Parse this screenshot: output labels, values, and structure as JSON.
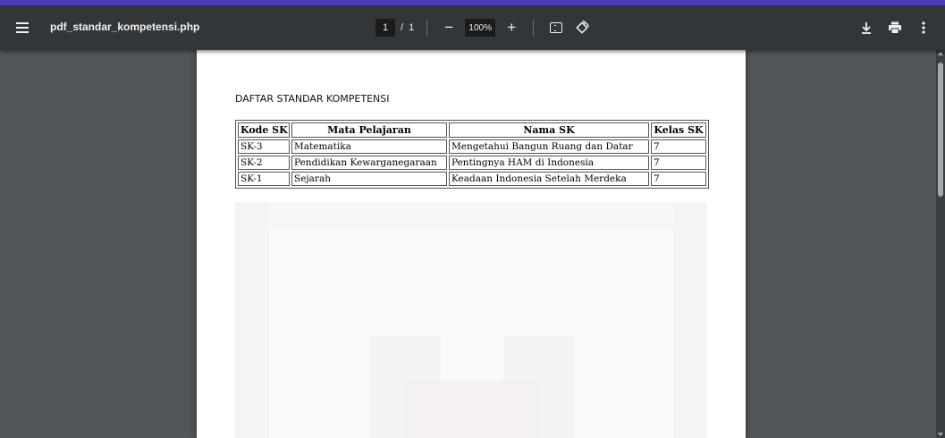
{
  "toolbar": {
    "file_name": "pdf_standar_kompetensi.php",
    "page_current": "1",
    "page_separator": "/",
    "page_total": "1",
    "zoom_level": "100%",
    "zoom_out_symbol": "−",
    "zoom_in_symbol": "+",
    "icons": [
      "menu-icon",
      "fit-page-icon",
      "rotate-icon",
      "download-icon",
      "print-icon",
      "more-options-icon"
    ]
  },
  "document": {
    "title": "DAFTAR STANDAR KOMPETENSI",
    "table": {
      "headers": [
        "Kode SK",
        "Mata Pelajaran",
        "Nama SK",
        "Kelas SK"
      ],
      "rows": [
        [
          "SK-3",
          "Matematika",
          "Mengetahui Bangun Ruang dan Datar",
          "7"
        ],
        [
          "SK-2",
          "Pendidikan Kewarganegaraan",
          "Pentingnya HAM di Indonesia",
          "7"
        ],
        [
          "SK-1",
          "Sejarah",
          "Keadaan Indonesia Setelah Merdeka",
          "7"
        ]
      ]
    }
  },
  "colors": {
    "accent": "#4a3fb8",
    "toolbar_bg": "#323639",
    "viewer_bg": "#525659",
    "page_bg": "#ffffff"
  }
}
